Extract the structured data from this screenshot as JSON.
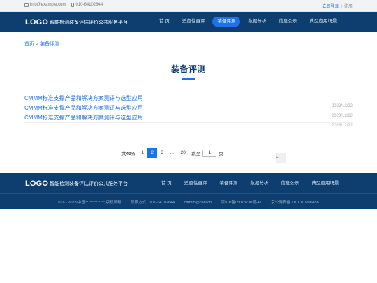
{
  "topbar": {
    "email": "info@example.com",
    "phone": "010-64102844",
    "login_label": "立即登录",
    "separator": "|",
    "register_label": "注册"
  },
  "header": {
    "logo": "LOGO",
    "site_name": "智能检测装备评估评价公共服务平台",
    "nav": [
      {
        "label": "首 页",
        "active": false
      },
      {
        "label": "适应性自评",
        "active": false
      },
      {
        "label": "装备评测",
        "active": true
      },
      {
        "label": "数据分析",
        "active": false
      },
      {
        "label": "信息公示",
        "active": false
      },
      {
        "label": "典型应用场景",
        "active": false
      }
    ]
  },
  "breadcrumb": {
    "home": "首页",
    "separator": ">",
    "current": "装备评测"
  },
  "page": {
    "title": "装备评测"
  },
  "list": [
    {
      "title": "CMMM标准支撑产品和解决方案测评与选型应用",
      "date": "2023/12/22"
    },
    {
      "title": "CMMM标准支撑产品和解决方案测评与选型应用",
      "date": "2023/12/22"
    },
    {
      "title": "CMMM标准支撑产品和解决方案测评与选型应用",
      "date": "2023/12/22"
    }
  ],
  "pagination": {
    "total_prefix": "共",
    "total_count": "40",
    "total_suffix": "条",
    "prev": "<",
    "pages": [
      "1",
      "2",
      "3",
      "...",
      "20"
    ],
    "current": "2",
    "next": ">",
    "jump_label": "跳至",
    "jump_value": "1",
    "jump_suffix": "页"
  },
  "footer": {
    "logo": "LOGO",
    "site_name": "智能检测装备评估评价公共服务平台",
    "nav": [
      "首 页",
      "适应性自评",
      "装备评测",
      "数据分析",
      "信息公示",
      "典型应用场景"
    ],
    "copyright": "018 - 2023 中国************* 版权所有",
    "contact": "联系方式：010-64102844",
    "email": "cmmm@ceei.cn",
    "icp": "京ICP备05013730号-47",
    "police": "京公网安备 1101010200458"
  },
  "colors": {
    "primary": "#0e3e6f",
    "accent": "#1a73e8"
  }
}
